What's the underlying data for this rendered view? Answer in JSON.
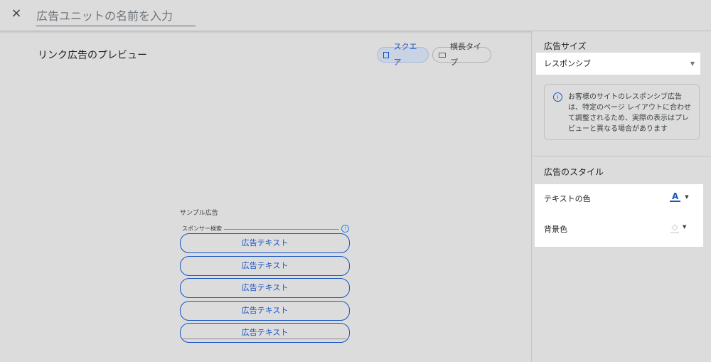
{
  "header": {
    "close_icon": "×",
    "ad_unit_name_placeholder": "広告ユニットの名前を入力"
  },
  "preview": {
    "title": "リンク広告のプレビュー",
    "toggles": [
      {
        "label": "スクエア",
        "selected": true
      },
      {
        "label": "横長タイプ",
        "selected": false
      }
    ],
    "sample_label": "サンプル広告",
    "sponsor_label": "スポンサー検索",
    "info_icon": "i",
    "ad_items": [
      "広告テキスト",
      "広告テキスト",
      "広告テキスト",
      "広告テキスト",
      "広告テキスト"
    ]
  },
  "sidebar": {
    "ad_size_title": "広告サイズ",
    "ad_size_value": "レスポンシブ",
    "info_icon": "i",
    "info_text": "お客様のサイトのレスポンシブ広告は、特定のページ レイアウトに合わせて調整されるため、実際の表示はプレビューと異なる場合があります",
    "ad_style_title": "広告のスタイル",
    "text_color_label": "テキストの色",
    "text_color_icon": "A",
    "bg_color_label": "背景色",
    "colors": {
      "accent": "#1a55c4",
      "background": "#dcdcdc"
    }
  }
}
